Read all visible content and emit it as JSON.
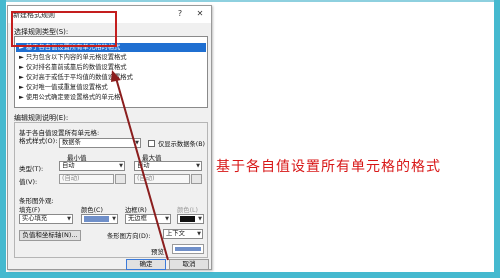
{
  "dialog": {
    "title": "新建格式规则",
    "help_icon": "?",
    "close_icon": "✕",
    "rule_type_label": "选择规则类型(S):",
    "rule_types": [
      "► 基于各自值设置所有单元格的格式",
      "► 只为包含以下内容的单元格设置格式",
      "► 仅对排名靠前或靠后的数值设置格式",
      "► 仅对高于或低于平均值的数值设置格式",
      "► 仅对唯一值或重复值设置格式",
      "► 使用公式确定要设置格式的单元格"
    ],
    "edit_label": "编辑规则说明(E):",
    "edit_heading": "基于各自值设置所有单元格:",
    "format_style_label": "格式样式(O):",
    "format_style_value": "数据条",
    "show_bar_only_label": "仅显示数据条(B)",
    "min_label": "最小值",
    "max_label": "最大值",
    "type_label": "类型(T):",
    "min_type": "自动",
    "max_type": "自动",
    "value_label": "值(V):",
    "min_value": "(自动)",
    "max_value": "(自动)",
    "bar_appearance_label": "条形图外观:",
    "fill_label": "填充(F)",
    "fill_value": "实心填充",
    "color_label": "颜色(C)",
    "border_label": "边框(R)",
    "border_value": "无边框",
    "border_color_label": "颜色(L)",
    "neg_axis_button": "负值和坐标轴(N)...",
    "bar_direction_label": "条形图方向(D):",
    "bar_direction_value": "上下文",
    "preview_label": "预览",
    "ok_button": "确定",
    "cancel_button": "取消"
  },
  "annotation": "基于各自值设置所有单元格的格式",
  "colors": {
    "background": "#8ed0df",
    "stripe": "#45b9cf",
    "selection": "#1f6fd1",
    "highlight": "#c41e1e",
    "annotation_text": "#d81818",
    "fill_color": "#6f8fc9"
  }
}
